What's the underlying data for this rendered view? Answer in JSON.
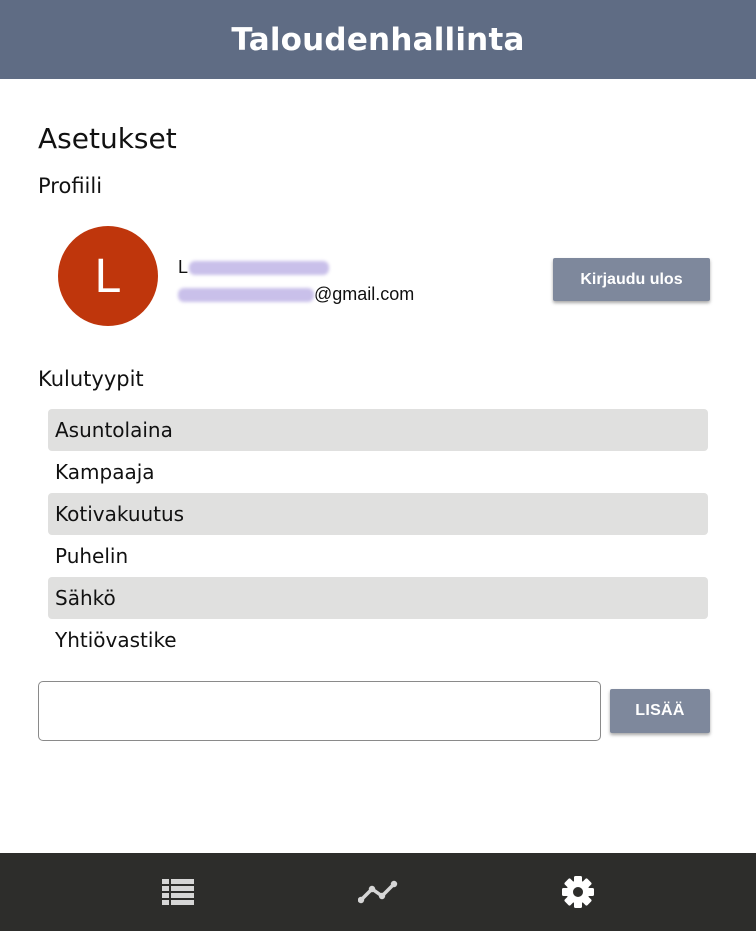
{
  "header": {
    "title": "Taloudenhallinta"
  },
  "page": {
    "title": "Asetukset"
  },
  "profile": {
    "section_title": "Profiili",
    "avatar_letter": "L",
    "name_visible": "L",
    "email_visible": "@gmail.com",
    "logout_label": "Kirjaudu ulos"
  },
  "expense_types": {
    "section_title": "Kulutyypit",
    "items": [
      {
        "label": "Asuntolaina"
      },
      {
        "label": "Kampaaja"
      },
      {
        "label": "Kotivakuutus"
      },
      {
        "label": "Puhelin"
      },
      {
        "label": "Sähkö"
      },
      {
        "label": "Yhtiövastike"
      }
    ],
    "input_value": "",
    "add_label": "LISÄÄ"
  },
  "bottom_nav": {
    "items": [
      {
        "icon": "list-icon"
      },
      {
        "icon": "chart-line-icon"
      },
      {
        "icon": "gear-icon"
      }
    ]
  },
  "colors": {
    "header_bg": "#5f6c84",
    "avatar_bg": "#bf360c",
    "button_bg": "#7e889c",
    "nav_bg": "#2d2d2b",
    "row_shade": "#e0e0df"
  }
}
